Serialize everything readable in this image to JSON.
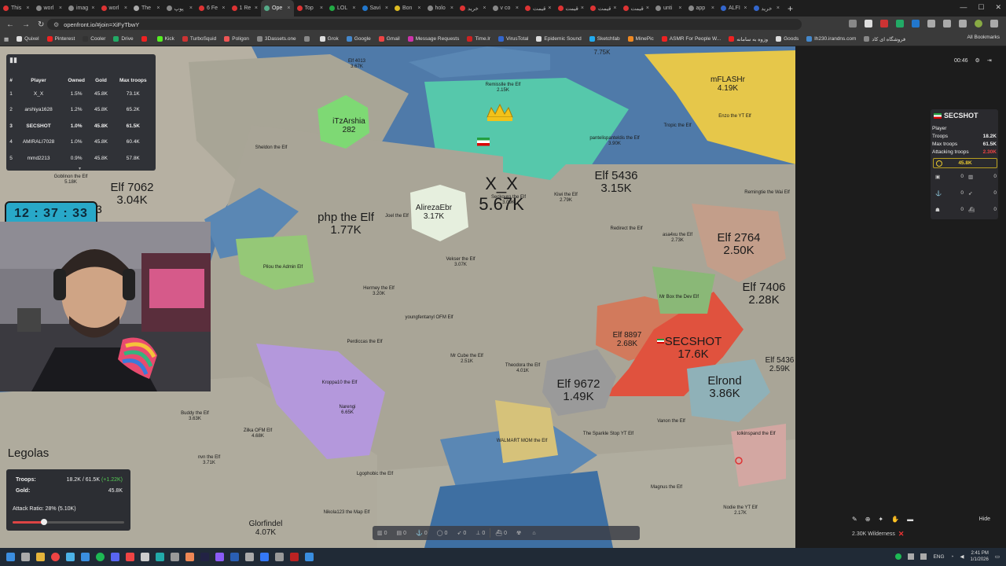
{
  "browser": {
    "tabs": [
      {
        "label": "This",
        "color": "#d33"
      },
      {
        "label": "worl",
        "color": "#888"
      },
      {
        "label": "imag",
        "color": "#888"
      },
      {
        "label": "worl",
        "color": "#d33"
      },
      {
        "label": "The",
        "color": "#aaa"
      },
      {
        "label": "پوپ",
        "color": "#888"
      },
      {
        "label": "6 Fe",
        "color": "#d33"
      },
      {
        "label": "1 Re",
        "color": "#d33"
      },
      {
        "label": "Ope",
        "color": "#5a8",
        "active": true
      },
      {
        "label": "Top",
        "color": "#d33"
      },
      {
        "label": "LOL",
        "color": "#2a4"
      },
      {
        "label": "Savi",
        "color": "#27c"
      },
      {
        "label": "Bon",
        "color": "#db2"
      },
      {
        "label": "holo",
        "color": "#888"
      },
      {
        "label": "خرید",
        "color": "#d33"
      },
      {
        "label": "v co",
        "color": "#888"
      },
      {
        "label": "قیمت",
        "color": "#d33"
      },
      {
        "label": "قیمت",
        "color": "#d33"
      },
      {
        "label": "قیمت",
        "color": "#d33"
      },
      {
        "label": "قیمت",
        "color": "#d33"
      },
      {
        "label": "unti",
        "color": "#888"
      },
      {
        "label": "app",
        "color": "#888"
      },
      {
        "label": "ALFI",
        "color": "#36c"
      },
      {
        "label": "خرید",
        "color": "#36c"
      }
    ],
    "url": "openfront.io/#join=XiFyTbwY",
    "bookmarks": [
      {
        "label": "Quixel",
        "color": "#ddd"
      },
      {
        "label": "Pinterest",
        "color": "#e22"
      },
      {
        "label": "Cooler",
        "color": "#333"
      },
      {
        "label": "Drive",
        "color": "#2a6"
      },
      {
        "label": "",
        "color": "#e22"
      },
      {
        "label": "Kick",
        "color": "#5e2"
      },
      {
        "label": "TurboSquid",
        "color": "#c33"
      },
      {
        "label": "Poligon",
        "color": "#e55"
      },
      {
        "label": "3Dassets.one",
        "color": "#888"
      },
      {
        "label": "",
        "color": "#888"
      },
      {
        "label": "Grok",
        "color": "#ddd"
      },
      {
        "label": "Google",
        "color": "#48c"
      },
      {
        "label": "Gmail",
        "color": "#e44"
      },
      {
        "label": "Message Requests",
        "color": "#c3a"
      },
      {
        "label": "Time.lr",
        "color": "#c22"
      },
      {
        "label": "VirusTotal",
        "color": "#36c"
      },
      {
        "label": "Epidemic Sound",
        "color": "#ddd"
      },
      {
        "label": "Sketchfab",
        "color": "#2ae"
      },
      {
        "label": "MinePic",
        "color": "#e82"
      },
      {
        "label": "ASMR For People W...",
        "color": "#e22"
      },
      {
        "label": "وزوه به سامانه",
        "color": "#e22"
      },
      {
        "label": "Goods",
        "color": "#ddd"
      },
      {
        "label": "lh230.irandns.com",
        "color": "#48c"
      },
      {
        "label": "فروشگاه ای کاد",
        "color": "#888"
      }
    ],
    "all_bookmarks": "All Bookmarks"
  },
  "leaderboard": {
    "headers": [
      "#",
      "Player",
      "Owned",
      "Gold",
      "Max troops"
    ],
    "rows": [
      [
        "1",
        "X_X",
        "1.5%",
        "45.8K",
        "73.1K"
      ],
      [
        "2",
        "arshiya1628",
        "1.2%",
        "45.8K",
        "65.2K"
      ],
      [
        "3",
        "SECSHOT",
        "1.0%",
        "45.8K",
        "61.5K"
      ],
      [
        "4",
        "AMIRALI7028",
        "1.0%",
        "45.8K",
        "60.4K"
      ],
      [
        "5",
        "mmd2213",
        "0.9%",
        "45.8K",
        "57.8K"
      ]
    ],
    "self_index": 2
  },
  "overlay": {
    "timer": "12 : 37 : 33",
    "timer_suffix": "3"
  },
  "map": {
    "regions": [
      {
        "name": "X_X",
        "troops": "5.67K",
        "size": "big",
        "crown": true,
        "flag": true
      },
      {
        "name": "SECSHOT",
        "troops": "17.6K",
        "size": "mid",
        "flag": true
      },
      {
        "name": "mFLASHr",
        "troops": "4.19K",
        "size": "small"
      },
      {
        "name": "iTzArshia",
        "troops": "282",
        "size": "small"
      },
      {
        "name": "AlirezaEbr",
        "troops": "3.17K",
        "size": "small"
      },
      {
        "name": "Narengi",
        "troops": "6.65K",
        "size": "tiny"
      },
      {
        "name": "Elf 7062",
        "troops": "3.04K",
        "size": "mid"
      },
      {
        "name": "php the Elf",
        "troops": "1.77K",
        "size": "mid"
      },
      {
        "name": "Elf 5436",
        "troops": "3.15K",
        "size": "mid"
      },
      {
        "name": "Elf 2764",
        "troops": "2.50K",
        "size": "mid"
      },
      {
        "name": "Elf 7406",
        "troops": "2.28K",
        "size": "mid"
      },
      {
        "name": "Elf 8897",
        "troops": "2.68K",
        "size": "small"
      },
      {
        "name": "Elf 9672",
        "troops": "1.49K",
        "size": "mid"
      },
      {
        "name": "Elrond",
        "troops": "3.86K",
        "size": "mid"
      },
      {
        "name": "Elf 5436",
        "troops": "2.59K",
        "size": "small"
      },
      {
        "name": "Legolas",
        "troops": "",
        "size": "mid"
      },
      {
        "name": "Glorfindel",
        "troops": "4.07K",
        "size": "small"
      },
      {
        "name": "Remisslle the Elf",
        "troops": "2.15K",
        "size": "tiny"
      },
      {
        "name": "Buddy the Elf",
        "troops": "3.63K",
        "size": "tiny"
      },
      {
        "name": "Mr Cube the Elf",
        "troops": "2.51K",
        "size": "tiny"
      },
      {
        "name": "Vekser the Elf",
        "troops": "3.07K",
        "size": "tiny"
      },
      {
        "name": "Hermey the Elf",
        "troops": "3.20K",
        "size": "tiny"
      },
      {
        "name": "Kiwi the Elf",
        "troops": "2.79K",
        "size": "tiny"
      },
      {
        "name": "Zilka OFM Elf",
        "troops": "4.68K",
        "size": "tiny"
      },
      {
        "name": "nvn the Elf",
        "troops": "3.71K",
        "size": "tiny"
      },
      {
        "name": "Goblinon the Elf",
        "troops": "5.18K",
        "size": "tiny"
      },
      {
        "name": "Sheldon the Elf",
        "troops": "",
        "size": "tiny"
      },
      {
        "name": "Elf 4013",
        "troops": "3.67K",
        "size": "tiny"
      },
      {
        "name": "Mr Box the Dev Elf",
        "troops": "",
        "size": "tiny"
      },
      {
        "name": "Theodora the Elf",
        "troops": "4.01K",
        "size": "tiny"
      },
      {
        "name": "Lgophobic the Elf",
        "troops": "",
        "size": "tiny"
      },
      {
        "name": "Nodie the YT Elf",
        "troops": "2.17K",
        "size": "tiny"
      },
      {
        "name": "Enzo the YT Elf",
        "troops": "",
        "size": "tiny"
      },
      {
        "name": "pantelispanteldis the Elf",
        "troops": "3.90K",
        "size": "tiny"
      },
      {
        "name": "Redirect the Elf",
        "troops": "",
        "size": "tiny"
      },
      {
        "name": "asa4xu the Elf",
        "troops": "2.73K",
        "size": "tiny"
      },
      {
        "name": "Perdiccas the Elf",
        "troops": "",
        "size": "tiny"
      },
      {
        "name": "youngfentanyl OFM Elf",
        "troops": "",
        "size": "tiny"
      },
      {
        "name": "Magnus the Elf",
        "troops": "",
        "size": "tiny"
      },
      {
        "name": "Vanon the Elf",
        "troops": "",
        "size": "tiny"
      },
      {
        "name": "The Sparkle Stop YT Elf",
        "troops": "",
        "size": "tiny"
      },
      {
        "name": "WALMART MOM the Elf",
        "troops": "",
        "size": "tiny"
      },
      {
        "name": "tolkinspand the Elf",
        "troops": "",
        "size": "tiny"
      },
      {
        "name": "Pilou the Admin Elf",
        "troops": "",
        "size": "tiny"
      },
      {
        "name": "Seckouro the Elf",
        "troops": "3.09K",
        "size": "tiny"
      },
      {
        "name": "Joel the Elf",
        "troops": "",
        "size": "tiny"
      },
      {
        "name": "Remingtie the Wai Elf",
        "troops": "",
        "size": "tiny"
      },
      {
        "name": "Nikola123 the Map Elf",
        "troops": "",
        "size": "tiny"
      },
      {
        "name": "Kroppa10 the Elf",
        "troops": "",
        "size": "tiny"
      },
      {
        "name": "Tropic the Elf",
        "troops": "",
        "size": "tiny"
      }
    ],
    "top_label": "7.75K"
  },
  "troops_panel": {
    "troops_label": "Troops:",
    "troops_value": "18.2K / 61.5K",
    "troops_delta": "(+1.22K)",
    "gold_label": "Gold:",
    "gold_value": "45.8K",
    "attack_label": "Attack Ratio: 28% (5.10K)",
    "attack_ratio": 0.28
  },
  "bottom_bar": [
    {
      "icon": "city-icon",
      "value": "0"
    },
    {
      "icon": "factory-icon",
      "value": "0"
    },
    {
      "icon": "anchor-icon",
      "value": "0"
    },
    {
      "icon": "shield-icon",
      "value": "0"
    },
    {
      "icon": "missile-icon",
      "value": "0"
    },
    {
      "icon": "sam-icon",
      "value": "0"
    },
    {
      "icon": "warship-icon",
      "value": "0"
    },
    {
      "icon": "nuke-icon",
      "value": ""
    },
    {
      "icon": "hydrogen-icon",
      "value": ""
    }
  ],
  "top_right": {
    "time": "00:46"
  },
  "player_card": {
    "name": "SECSHOT",
    "role": "Player",
    "troops_label": "Troops",
    "troops": "18.2K",
    "max_label": "Max troops",
    "max": "61.5K",
    "attacking_label": "Attacking troops",
    "attacking": "2.30K",
    "gold": "45.8K",
    "stats": [
      "0",
      "0",
      "0",
      "0",
      "0",
      "0"
    ]
  },
  "tool_row": {
    "hide": "Hide"
  },
  "wilderness": "2.30K Wilderness",
  "taskbar": {
    "lang": "ENG",
    "time": "2:41 PM",
    "date": "1/1/2026"
  },
  "colors": {
    "self": "#e0523e",
    "accent": "#28a8c8"
  }
}
